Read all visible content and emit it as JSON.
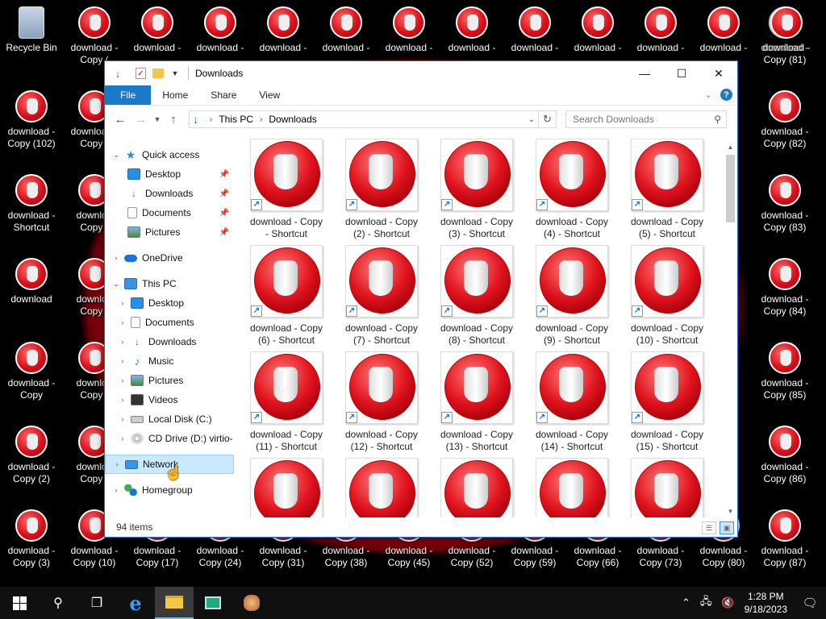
{
  "desktop": {
    "left_icons": [
      {
        "line1": "Recycle Bin",
        "line2": ""
      },
      {
        "line1": "download -",
        "line2": "Copy (102)"
      },
      {
        "line1": "download -",
        "line2": "Shortcut"
      },
      {
        "line1": "download",
        "line2": ""
      },
      {
        "line1": "download -",
        "line2": "Copy"
      },
      {
        "line1": "download -",
        "line2": "Copy (2)"
      },
      {
        "line1": "download -",
        "line2": "Copy (3)"
      }
    ],
    "second_col": [
      {
        "line1": "download -",
        "line2": "Copy ("
      },
      {
        "line1": "download -",
        "line2": "Copy ("
      },
      {
        "line1": "downloa",
        "line2": "Copy ("
      },
      {
        "line1": "downloa",
        "line2": "Copy ("
      },
      {
        "line1": "downloa",
        "line2": "Copy ("
      },
      {
        "line1": "downloa",
        "line2": "Copy ("
      },
      {
        "line1": "download -",
        "line2": "Copy (10)"
      }
    ],
    "top_row": [
      "download -",
      "download -",
      "download -",
      "download -",
      "download -",
      "download -",
      "download -",
      "download -",
      "download -",
      "download -",
      "download -"
    ],
    "right_col": [
      {
        "line1": "download -",
        "line2": "Copy (81)"
      },
      {
        "line1": "download -",
        "line2": "Copy (82)"
      },
      {
        "line1": "download -",
        "line2": "Copy (83)"
      },
      {
        "line1": "download -",
        "line2": "Copy (84)"
      },
      {
        "line1": "download -",
        "line2": "Copy (85)"
      },
      {
        "line1": "download -",
        "line2": "Copy (86)"
      },
      {
        "line1": "download -",
        "line2": "Copy (87)"
      }
    ],
    "bottom_row": [
      {
        "line1": "download -",
        "line2": "Copy (17)"
      },
      {
        "line1": "download -",
        "line2": "Copy (24)"
      },
      {
        "line1": "download -",
        "line2": "Copy (31)"
      },
      {
        "line1": "download -",
        "line2": "Copy (38)"
      },
      {
        "line1": "download -",
        "line2": "Copy (45)"
      },
      {
        "line1": "download -",
        "line2": "Copy (52)"
      },
      {
        "line1": "download -",
        "line2": "Copy (59)"
      },
      {
        "line1": "download -",
        "line2": "Copy (66)"
      },
      {
        "line1": "download -",
        "line2": "Copy (73)"
      },
      {
        "line1": "download -",
        "line2": "Copy (80)"
      }
    ]
  },
  "window": {
    "title": "Downloads",
    "controls": {
      "minimize": "—",
      "maximize": "☐",
      "close": "✕"
    },
    "ribbon_tabs": [
      "File",
      "Home",
      "Share",
      "View"
    ],
    "address": {
      "root": "This PC",
      "current": "Downloads"
    },
    "search_placeholder": "Search Downloads",
    "nav": [
      {
        "label": "Quick access",
        "icon": "star-icon",
        "level": 0,
        "twisty": "⌄"
      },
      {
        "label": "Desktop",
        "icon": "desktop-icon",
        "level": 1,
        "pinned": true
      },
      {
        "label": "Downloads",
        "icon": "downloads-icon",
        "level": 1,
        "pinned": true
      },
      {
        "label": "Documents",
        "icon": "documents-icon",
        "level": 1,
        "pinned": true
      },
      {
        "label": "Pictures",
        "icon": "pictures-icon",
        "level": 1,
        "pinned": true
      },
      {
        "label": "OneDrive",
        "icon": "onedrive-icon",
        "level": 0,
        "twisty": "›"
      },
      {
        "label": "This PC",
        "icon": "this-pc-icon",
        "level": 0,
        "twisty": "⌄"
      },
      {
        "label": "Desktop",
        "icon": "desktop-icon",
        "level": 1,
        "twisty": "›"
      },
      {
        "label": "Documents",
        "icon": "documents-icon",
        "level": 1,
        "twisty": "›"
      },
      {
        "label": "Downloads",
        "icon": "downloads-icon",
        "level": 1,
        "twisty": "›"
      },
      {
        "label": "Music",
        "icon": "music-icon",
        "level": 1,
        "twisty": "›"
      },
      {
        "label": "Pictures",
        "icon": "pictures-icon",
        "level": 1,
        "twisty": "›"
      },
      {
        "label": "Videos",
        "icon": "videos-icon",
        "level": 1,
        "twisty": "›"
      },
      {
        "label": "Local Disk (C:)",
        "icon": "local-disk-icon",
        "level": 1,
        "twisty": "›"
      },
      {
        "label": "CD Drive (D:) virtio-",
        "icon": "cd-drive-icon",
        "level": 1,
        "twisty": "›"
      },
      {
        "label": "Network",
        "icon": "network-icon",
        "level": 0,
        "twisty": "›",
        "selected": true
      },
      {
        "label": "Homegroup",
        "icon": "homegroup-icon",
        "level": 0,
        "twisty": "›"
      }
    ],
    "files": [
      {
        "line1": "download - Copy",
        "line2": "- Shortcut"
      },
      {
        "line1": "download - Copy",
        "line2": "(2) - Shortcut"
      },
      {
        "line1": "download - Copy",
        "line2": "(3) - Shortcut"
      },
      {
        "line1": "download - Copy",
        "line2": "(4) - Shortcut"
      },
      {
        "line1": "download - Copy",
        "line2": "(5) - Shortcut"
      },
      {
        "line1": "download - Copy",
        "line2": "(6) - Shortcut"
      },
      {
        "line1": "download - Copy",
        "line2": "(7) - Shortcut"
      },
      {
        "line1": "download - Copy",
        "line2": "(8) - Shortcut"
      },
      {
        "line1": "download - Copy",
        "line2": "(9) - Shortcut"
      },
      {
        "line1": "download - Copy",
        "line2": "(10) - Shortcut"
      },
      {
        "line1": "download - Copy",
        "line2": "(11) - Shortcut"
      },
      {
        "line1": "download - Copy",
        "line2": "(12) - Shortcut"
      },
      {
        "line1": "download - Copy",
        "line2": "(13) - Shortcut"
      },
      {
        "line1": "download - Copy",
        "line2": "(14) - Shortcut"
      },
      {
        "line1": "download - Copy",
        "line2": "(15) - Shortcut"
      },
      {
        "line1": "",
        "line2": ""
      },
      {
        "line1": "",
        "line2": ""
      },
      {
        "line1": "",
        "line2": ""
      },
      {
        "line1": "",
        "line2": ""
      },
      {
        "line1": "",
        "line2": ""
      }
    ],
    "status": "94 items"
  },
  "taskbar": {
    "time": "1:28 PM",
    "date": "9/18/2023",
    "apps": [
      "start-icon",
      "search-icon",
      "task-view-icon",
      "internet-explorer-icon",
      "file-explorer-icon",
      "app-icon",
      "paint-icon"
    ]
  }
}
